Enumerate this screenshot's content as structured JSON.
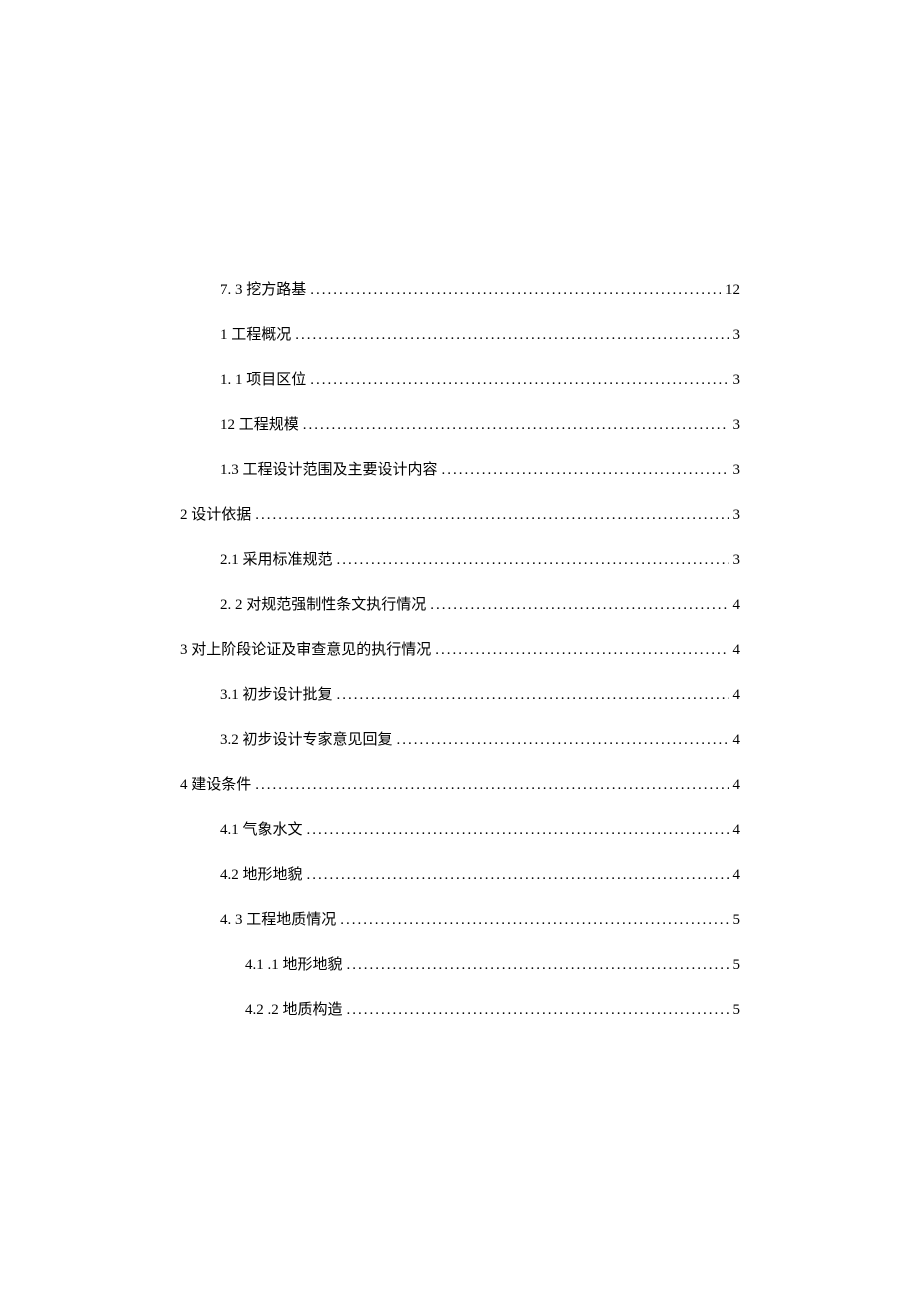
{
  "toc": [
    {
      "level": 1,
      "label": "7.   3 挖方路基",
      "page": "12"
    },
    {
      "level": 1,
      "label": "1 工程概况",
      "page": "3"
    },
    {
      "level": 1,
      "label": "1.   1 项目区位",
      "page": "3"
    },
    {
      "level": 1,
      "label": "12 工程规模",
      "page": "3"
    },
    {
      "level": 1,
      "label": "1.3 工程设计范围及主要设计内容",
      "page": "3"
    },
    {
      "level": 0,
      "label": "2 设计依据",
      "page": "3"
    },
    {
      "level": 1,
      "label": "2.1 采用标准规范",
      "page": "3"
    },
    {
      "level": 1,
      "label": "2.   2 对规范强制性条文执行情况",
      "page": "4"
    },
    {
      "level": 0,
      "label": "3 对上阶段论证及审查意见的执行情况",
      "page": "4"
    },
    {
      "level": 1,
      "label": "3.1    初步设计批复",
      "page": "4"
    },
    {
      "level": 1,
      "label": "3.2    初步设计专家意见回复",
      "page": "4"
    },
    {
      "level": 0,
      "label": "4 建设条件",
      "page": "4"
    },
    {
      "level": 1,
      "label": "4.1 气象水文",
      "page": "4"
    },
    {
      "level": 1,
      "label": "4.2 地形地貌",
      "page": "4"
    },
    {
      "level": 1,
      "label": "4.   3 工程地质情况",
      "page": "5"
    },
    {
      "level": 2,
      "label": "4.1   .1 地形地貌",
      "page": "5"
    },
    {
      "level": 2,
      "label": "4.2   .2 地质构造",
      "page": "5"
    }
  ]
}
